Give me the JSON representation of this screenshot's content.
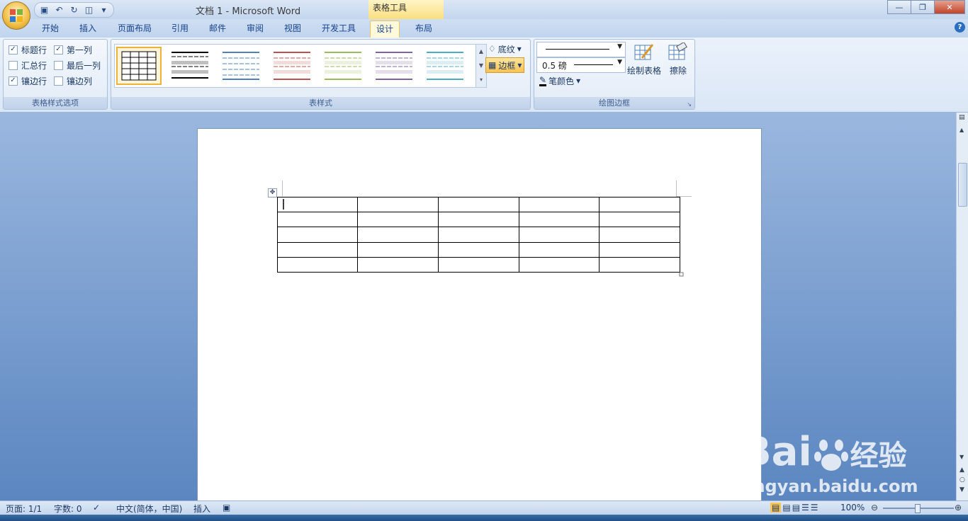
{
  "window": {
    "title": "文档 1 - Microsoft Word",
    "context_tab": "表格工具"
  },
  "qat": {
    "icons": [
      "save-icon",
      "undo-icon",
      "redo-icon",
      "print-preview-icon",
      "customize-icon"
    ]
  },
  "tabs": [
    "开始",
    "插入",
    "页面布局",
    "引用",
    "邮件",
    "审阅",
    "视图",
    "开发工具",
    "设计",
    "布局"
  ],
  "active_tab": "设计",
  "ribbon": {
    "options_group": {
      "label": "表格样式选项",
      "items": [
        {
          "label": "标题行",
          "checked": true
        },
        {
          "label": "第一列",
          "checked": true
        },
        {
          "label": "汇总行",
          "checked": false
        },
        {
          "label": "最后一列",
          "checked": false
        },
        {
          "label": "镶边行",
          "checked": true
        },
        {
          "label": "镶边列",
          "checked": false
        }
      ]
    },
    "styles_group": {
      "label": "表样式",
      "style_colors": [
        "#000000",
        "#000000",
        "#4f81bd",
        "#c0504d",
        "#9bbb59",
        "#8064a2",
        "#4bacc6"
      ],
      "shading_label": "底纹",
      "borders_label": "边框"
    },
    "draw_group": {
      "label": "绘图边框",
      "line_weight": "0.5 磅",
      "pen_color_label": "笔颜色",
      "draw_table_label": "绘制表格",
      "eraser_label": "擦除"
    }
  },
  "status": {
    "page": "页面: 1/1",
    "words": "字数: 0",
    "language": "中文(简体，中国)",
    "mode": "插入",
    "zoom": "100%"
  },
  "table": {
    "rows": 5,
    "cols": 5
  },
  "watermark": {
    "brand": "Bai",
    "brand_cn": "经验",
    "url": "jingyan.baidu.com"
  },
  "colors": {
    "accent": "#f8c354",
    "ribbon": "#dbe7f6",
    "doc_bg": "#6f97cf"
  }
}
